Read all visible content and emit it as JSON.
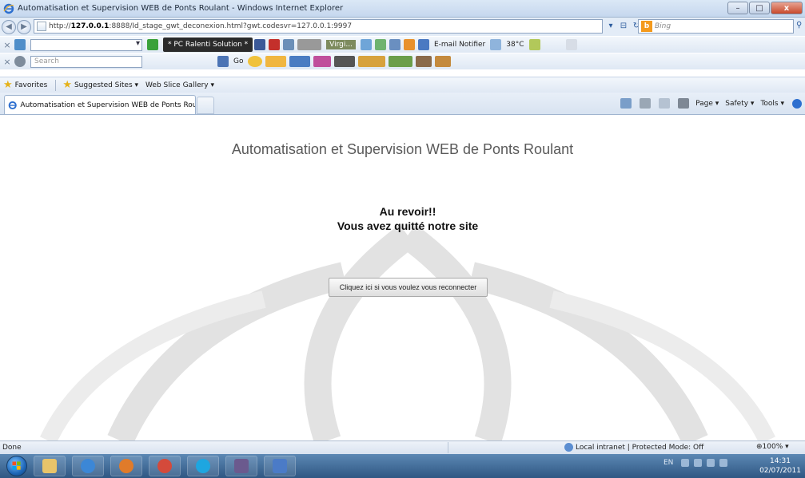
{
  "window": {
    "title": "Automatisation et Supervision WEB de Ponts Roulant - Windows Internet Explorer"
  },
  "addressbar": {
    "url_prefix": "http://",
    "url_host": "127.0.0.1",
    "url_rest": ":8888/Id_stage_gwt_deconexion.html?gwt.codesvr=127.0.0.1:9997",
    "search_placeholder": "Bing"
  },
  "toolbar": {
    "search_placeholder": "Search",
    "pc_badge": "* PC Ralenti Solution *",
    "virgil_label": "Virgi...",
    "email_notifier": "E-mail Notifier",
    "temperature": "38°C",
    "go_label": "Go"
  },
  "favorites": {
    "favorites_label": "Favorites",
    "suggested_sites": "Suggested Sites ▾",
    "web_slice": "Web Slice Gallery ▾"
  },
  "tab": {
    "label": "Automatisation et Supervision WEB de Ponts Rou..."
  },
  "commandbar": {
    "page": "Page ▾",
    "safety": "Safety ▾",
    "tools": "Tools ▾"
  },
  "content": {
    "title": "Automatisation et Supervision WEB de Ponts Roulant",
    "goodbye_line1": "Au revoir!!",
    "goodbye_line2": "Vous avez quitté notre site",
    "reconnect_button": "Cliquez ici si vous voulez vous reconnecter"
  },
  "statusbar": {
    "status": "Done",
    "zone": "Local intranet | Protected Mode: Off",
    "zoom": "100%"
  },
  "taskbar": {
    "lang": "EN",
    "time": "14:31",
    "date": "02/07/2011"
  },
  "colors": {
    "ie_blue": "#2d6fcf",
    "taskbar": "#2f5783"
  }
}
